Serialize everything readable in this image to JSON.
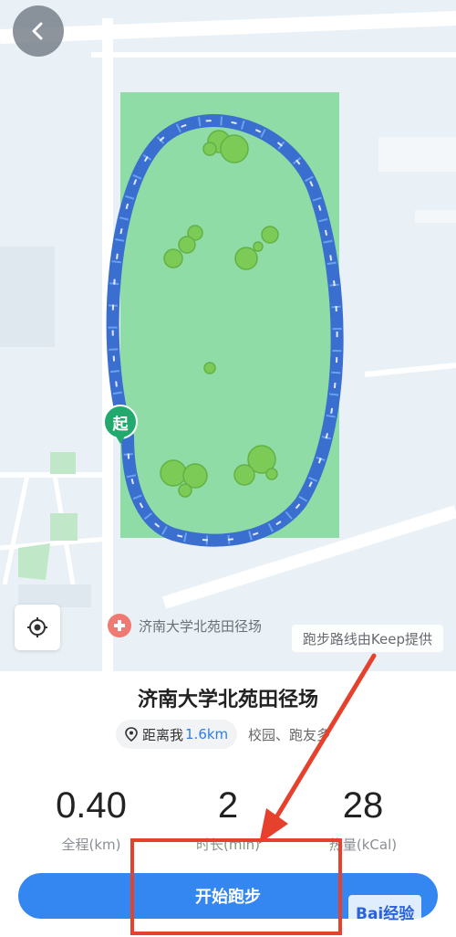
{
  "map": {
    "start_marker": "起",
    "poi_label": "济南大学北苑田径场",
    "route_credit": "跑步路线由Keep提供",
    "icons": [
      "back-icon",
      "locate-icon",
      "hospital-icon"
    ]
  },
  "track": {
    "name": "济南大学北苑田径场",
    "distance_label": "距离我",
    "distance_value": "1.6km",
    "tags": "校园、跑友多"
  },
  "stats": [
    {
      "value": "0.40",
      "label": "全程(km)"
    },
    {
      "value": "2",
      "label": "时长(min)"
    },
    {
      "value": "28",
      "label": "热量(kCal)"
    }
  ],
  "actions": {
    "start_label": "开始跑步"
  },
  "watermark": "Bai经验",
  "colors": {
    "route": "#5a96ea",
    "park": "#8fdca6",
    "start_button": "#3487f0",
    "annotation": "#e5412d"
  }
}
